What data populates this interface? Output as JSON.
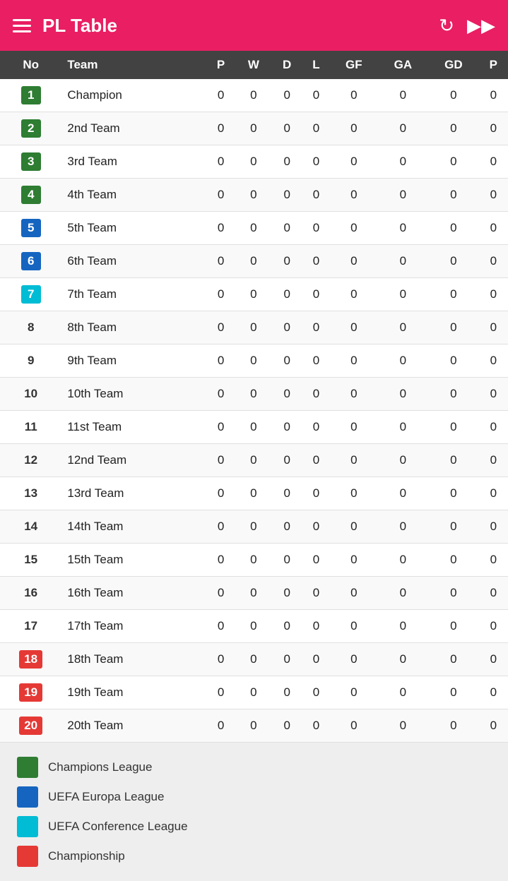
{
  "header": {
    "title": "PL Table",
    "menu_icon": "menu",
    "refresh_icon": "↻",
    "forward_icon": "▶▶"
  },
  "table": {
    "columns": [
      "No",
      "Team",
      "P",
      "W",
      "D",
      "L",
      "GF",
      "GA",
      "GD",
      "P"
    ],
    "rows": [
      {
        "no": 1,
        "team": "Champion",
        "p": 0,
        "w": 0,
        "d": 0,
        "l": 0,
        "gf": 0,
        "ga": 0,
        "gd": 0,
        "pts": 0,
        "rank_class": "rank-green"
      },
      {
        "no": 2,
        "team": "2nd Team",
        "p": 0,
        "w": 0,
        "d": 0,
        "l": 0,
        "gf": 0,
        "ga": 0,
        "gd": 0,
        "pts": 0,
        "rank_class": "rank-green"
      },
      {
        "no": 3,
        "team": "3rd Team",
        "p": 0,
        "w": 0,
        "d": 0,
        "l": 0,
        "gf": 0,
        "ga": 0,
        "gd": 0,
        "pts": 0,
        "rank_class": "rank-green"
      },
      {
        "no": 4,
        "team": "4th Team",
        "p": 0,
        "w": 0,
        "d": 0,
        "l": 0,
        "gf": 0,
        "ga": 0,
        "gd": 0,
        "pts": 0,
        "rank_class": "rank-green"
      },
      {
        "no": 5,
        "team": "5th Team",
        "p": 0,
        "w": 0,
        "d": 0,
        "l": 0,
        "gf": 0,
        "ga": 0,
        "gd": 0,
        "pts": 0,
        "rank_class": "rank-blue"
      },
      {
        "no": 6,
        "team": "6th Team",
        "p": 0,
        "w": 0,
        "d": 0,
        "l": 0,
        "gf": 0,
        "ga": 0,
        "gd": 0,
        "pts": 0,
        "rank_class": "rank-blue"
      },
      {
        "no": 7,
        "team": "7th Team",
        "p": 0,
        "w": 0,
        "d": 0,
        "l": 0,
        "gf": 0,
        "ga": 0,
        "gd": 0,
        "pts": 0,
        "rank_class": "rank-cyan"
      },
      {
        "no": 8,
        "team": "8th Team",
        "p": 0,
        "w": 0,
        "d": 0,
        "l": 0,
        "gf": 0,
        "ga": 0,
        "gd": 0,
        "pts": 0,
        "rank_class": "rank-default"
      },
      {
        "no": 9,
        "team": "9th Team",
        "p": 0,
        "w": 0,
        "d": 0,
        "l": 0,
        "gf": 0,
        "ga": 0,
        "gd": 0,
        "pts": 0,
        "rank_class": "rank-default"
      },
      {
        "no": 10,
        "team": "10th Team",
        "p": 0,
        "w": 0,
        "d": 0,
        "l": 0,
        "gf": 0,
        "ga": 0,
        "gd": 0,
        "pts": 0,
        "rank_class": "rank-default"
      },
      {
        "no": 11,
        "team": "11st Team",
        "p": 0,
        "w": 0,
        "d": 0,
        "l": 0,
        "gf": 0,
        "ga": 0,
        "gd": 0,
        "pts": 0,
        "rank_class": "rank-default"
      },
      {
        "no": 12,
        "team": "12nd Team",
        "p": 0,
        "w": 0,
        "d": 0,
        "l": 0,
        "gf": 0,
        "ga": 0,
        "gd": 0,
        "pts": 0,
        "rank_class": "rank-default"
      },
      {
        "no": 13,
        "team": "13rd Team",
        "p": 0,
        "w": 0,
        "d": 0,
        "l": 0,
        "gf": 0,
        "ga": 0,
        "gd": 0,
        "pts": 0,
        "rank_class": "rank-default"
      },
      {
        "no": 14,
        "team": "14th Team",
        "p": 0,
        "w": 0,
        "d": 0,
        "l": 0,
        "gf": 0,
        "ga": 0,
        "gd": 0,
        "pts": 0,
        "rank_class": "rank-default"
      },
      {
        "no": 15,
        "team": "15th Team",
        "p": 0,
        "w": 0,
        "d": 0,
        "l": 0,
        "gf": 0,
        "ga": 0,
        "gd": 0,
        "pts": 0,
        "rank_class": "rank-default"
      },
      {
        "no": 16,
        "team": "16th Team",
        "p": 0,
        "w": 0,
        "d": 0,
        "l": 0,
        "gf": 0,
        "ga": 0,
        "gd": 0,
        "pts": 0,
        "rank_class": "rank-default"
      },
      {
        "no": 17,
        "team": "17th Team",
        "p": 0,
        "w": 0,
        "d": 0,
        "l": 0,
        "gf": 0,
        "ga": 0,
        "gd": 0,
        "pts": 0,
        "rank_class": "rank-default"
      },
      {
        "no": 18,
        "team": "18th Team",
        "p": 0,
        "w": 0,
        "d": 0,
        "l": 0,
        "gf": 0,
        "ga": 0,
        "gd": 0,
        "pts": 0,
        "rank_class": "rank-red"
      },
      {
        "no": 19,
        "team": "19th Team",
        "p": 0,
        "w": 0,
        "d": 0,
        "l": 0,
        "gf": 0,
        "ga": 0,
        "gd": 0,
        "pts": 0,
        "rank_class": "rank-red"
      },
      {
        "no": 20,
        "team": "20th Team",
        "p": 0,
        "w": 0,
        "d": 0,
        "l": 0,
        "gf": 0,
        "ga": 0,
        "gd": 0,
        "pts": 0,
        "rank_class": "rank-red"
      }
    ]
  },
  "legend": {
    "items": [
      {
        "label": "Champions League",
        "color_class": "leg-green"
      },
      {
        "label": "UEFA Europa League",
        "color_class": "leg-blue"
      },
      {
        "label": "UEFA Conference League",
        "color_class": "leg-cyan"
      },
      {
        "label": "Championship",
        "color_class": "leg-red"
      }
    ]
  }
}
